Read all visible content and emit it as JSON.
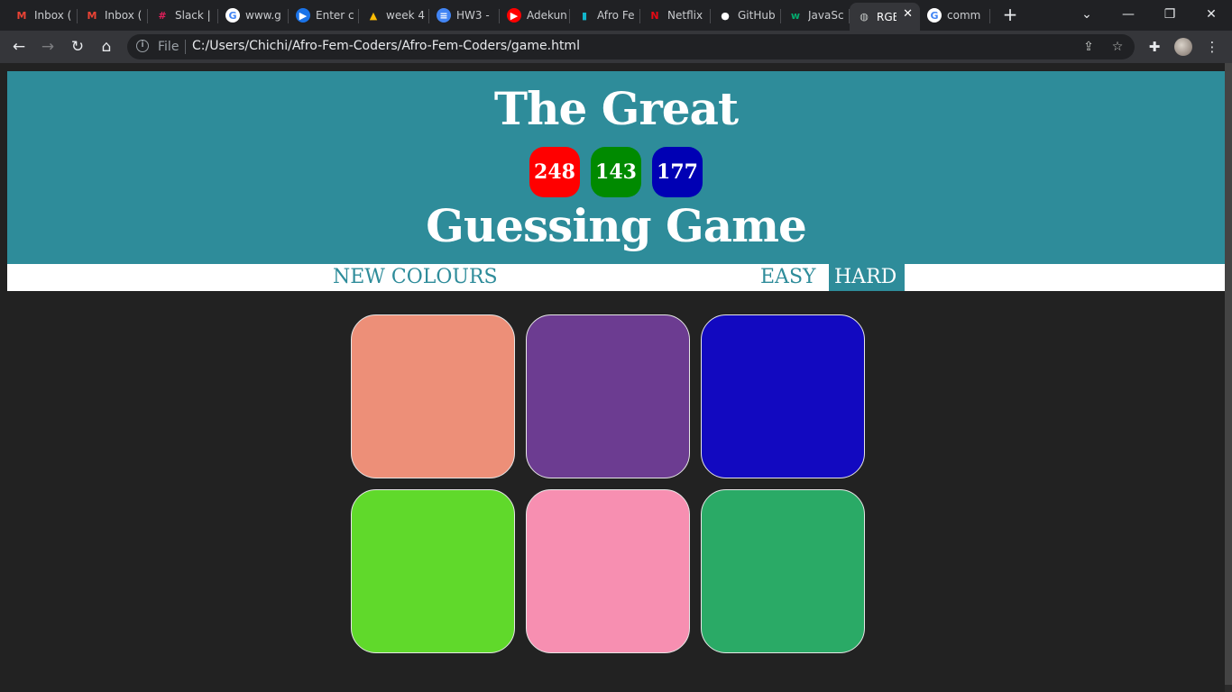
{
  "browser": {
    "tabs": [
      {
        "title": "Inbox (",
        "icon": "gmail-icon",
        "glyph": "M",
        "color": "#ea4335",
        "bg": "transparent"
      },
      {
        "title": "Inbox (",
        "icon": "gmail-icon",
        "glyph": "M",
        "color": "#ea4335",
        "bg": "transparent"
      },
      {
        "title": "Slack |",
        "icon": "slack-icon",
        "glyph": "#",
        "color": "#e01e5a",
        "bg": "transparent"
      },
      {
        "title": "www.g",
        "icon": "google-icon",
        "glyph": "G",
        "color": "#4285f4",
        "bg": "#ffffff"
      },
      {
        "title": "Enter c",
        "icon": "play-icon",
        "glyph": "▶",
        "color": "#ffffff",
        "bg": "#1a73e8"
      },
      {
        "title": "week 4",
        "icon": "google-drive-icon",
        "glyph": "▲",
        "color": "#fbbc04",
        "bg": "transparent"
      },
      {
        "title": "HW3 -",
        "icon": "google-docs-icon",
        "glyph": "≡",
        "color": "#ffffff",
        "bg": "#4285f4"
      },
      {
        "title": "Adekun",
        "icon": "youtube-icon",
        "glyph": "▶",
        "color": "#ffffff",
        "bg": "#ff0000"
      },
      {
        "title": "Afro Fe",
        "icon": "analytics-icon",
        "glyph": "▮",
        "color": "#12b5cb",
        "bg": "transparent"
      },
      {
        "title": "Netflix",
        "icon": "netflix-icon",
        "glyph": "N",
        "color": "#e50914",
        "bg": "transparent"
      },
      {
        "title": "GitHub",
        "icon": "github-icon",
        "glyph": "●",
        "color": "#ffffff",
        "bg": "transparent"
      },
      {
        "title": "JavaSc",
        "icon": "w3schools-icon",
        "glyph": "w",
        "color": "#04aa6d",
        "bg": "transparent"
      },
      {
        "title": "RGB",
        "icon": "globe-icon",
        "glyph": "◍",
        "color": "#c4c7c5",
        "bg": "transparent"
      },
      {
        "title": "comm",
        "icon": "google-icon",
        "glyph": "G",
        "color": "#4285f4",
        "bg": "#ffffff"
      }
    ],
    "active_tab_index": 12,
    "new_tab_glyph": "+",
    "window": {
      "tab_search": "⌄",
      "minimize": "—",
      "restore": "❐",
      "close": "✕"
    },
    "address": {
      "scheme_label": "File",
      "url": "C:/Users/Chichi/Afro-Fem-Coders/Afro-Fem-Coders/game.html"
    },
    "nav": {
      "back": "←",
      "forward": "→",
      "reload": "↻",
      "home": "⌂"
    },
    "toolbar_icons": {
      "share": "⇪",
      "bookmark": "☆",
      "extensions": "✚",
      "menu": "⋮"
    }
  },
  "game": {
    "title_top": "The Great",
    "title_bottom": "Guessing Game",
    "rgb": {
      "r": {
        "value": "248",
        "color": "#ff0000"
      },
      "g": {
        "value": "143",
        "color": "#008a00"
      },
      "b": {
        "value": "177",
        "color": "#0000b4"
      }
    },
    "header_color": "#2e8c9a",
    "controls": {
      "new_colours": "NEW COLOURS",
      "easy": "EASY",
      "hard": "HARD",
      "selected_mode": "HARD"
    },
    "squares": [
      {
        "color": "#ed8f78"
      },
      {
        "color": "#6c3c91"
      },
      {
        "color": "#1209c0"
      },
      {
        "color": "#60d92b"
      },
      {
        "color": "#f78fb1"
      },
      {
        "color": "#2aaa66"
      }
    ]
  }
}
